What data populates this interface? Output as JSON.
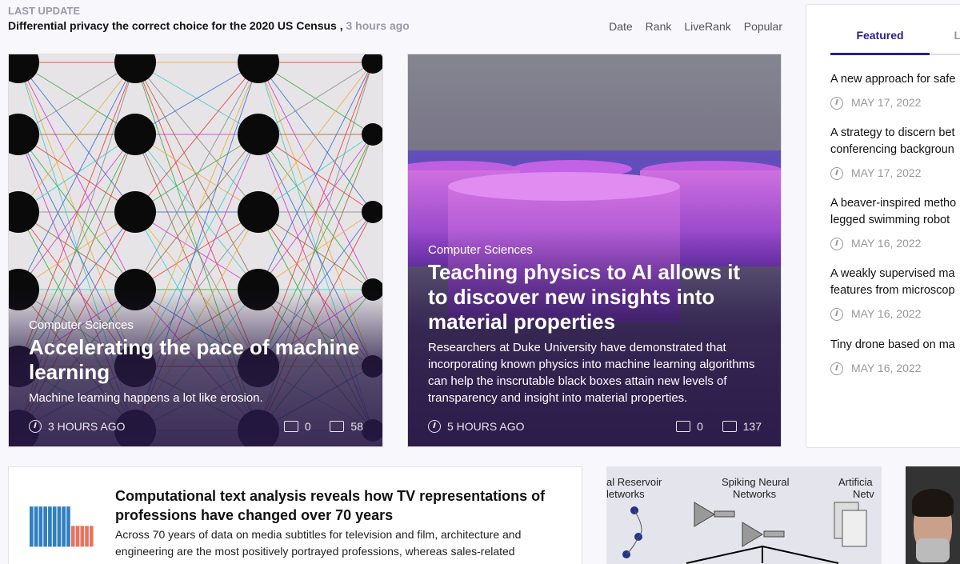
{
  "last_update": {
    "label": "LAST UPDATE",
    "headline": "Differential privacy the correct choice for the 2020 US Census",
    "separator": ",",
    "ago": "3 hours ago"
  },
  "sort_links": [
    "Date",
    "Rank",
    "LiveRank",
    "Popular"
  ],
  "cards": [
    {
      "category": "Computer Sciences",
      "title": "Accelerating the pace of machine learning",
      "description": "Machine learning happens a lot like erosion.",
      "time": "3 HOURS AGO",
      "comments": "0",
      "shares": "58",
      "icons": [
        "clock-icon",
        "comment-icon",
        "share-icon"
      ]
    },
    {
      "category": "Computer Sciences",
      "title": "Teaching physics to AI allows it to discover new insights into material properties",
      "description": "Researchers at Duke University have demonstrated that incorporating known physics into machine learning algorithms can help the inscrutable black boxes attain new levels of transparency and insight into material properties.",
      "time": "5 HOURS AGO",
      "comments": "0",
      "shares": "137"
    }
  ],
  "sidebar": {
    "tabs": [
      "Featured",
      "L"
    ],
    "active_tab": "Featured",
    "accent": "#2a1f8a",
    "items": [
      {
        "title": [
          "A new approach for safe"
        ],
        "date": "MAY 17, 2022"
      },
      {
        "title": [
          "A strategy to discern bet",
          "conferencing backgroun"
        ],
        "date": "MAY 17, 2022"
      },
      {
        "title": [
          "A beaver-inspired metho",
          "legged swimming robot"
        ],
        "date": "MAY 16, 2022"
      },
      {
        "title": [
          "A weakly supervised ma",
          "features from microscop"
        ],
        "date": "MAY 16, 2022"
      },
      {
        "title": [
          "Tiny drone based on ma"
        ],
        "date": "MAY 16, 2022"
      }
    ]
  },
  "bottom_article": {
    "title": "Computational text analysis reveals how TV representations of professions have changed over 70 years",
    "description": "Across 70 years of data on media subtitles for television and film, architecture and engineering are the most positively portrayed professions, whereas sales-related"
  },
  "diagram_labels": {
    "a": "al Reservoir",
    "a2": "letworks",
    "b": "Spiking Neural",
    "b2": "Networks",
    "c": "Artificia",
    "c2": "Netv"
  }
}
